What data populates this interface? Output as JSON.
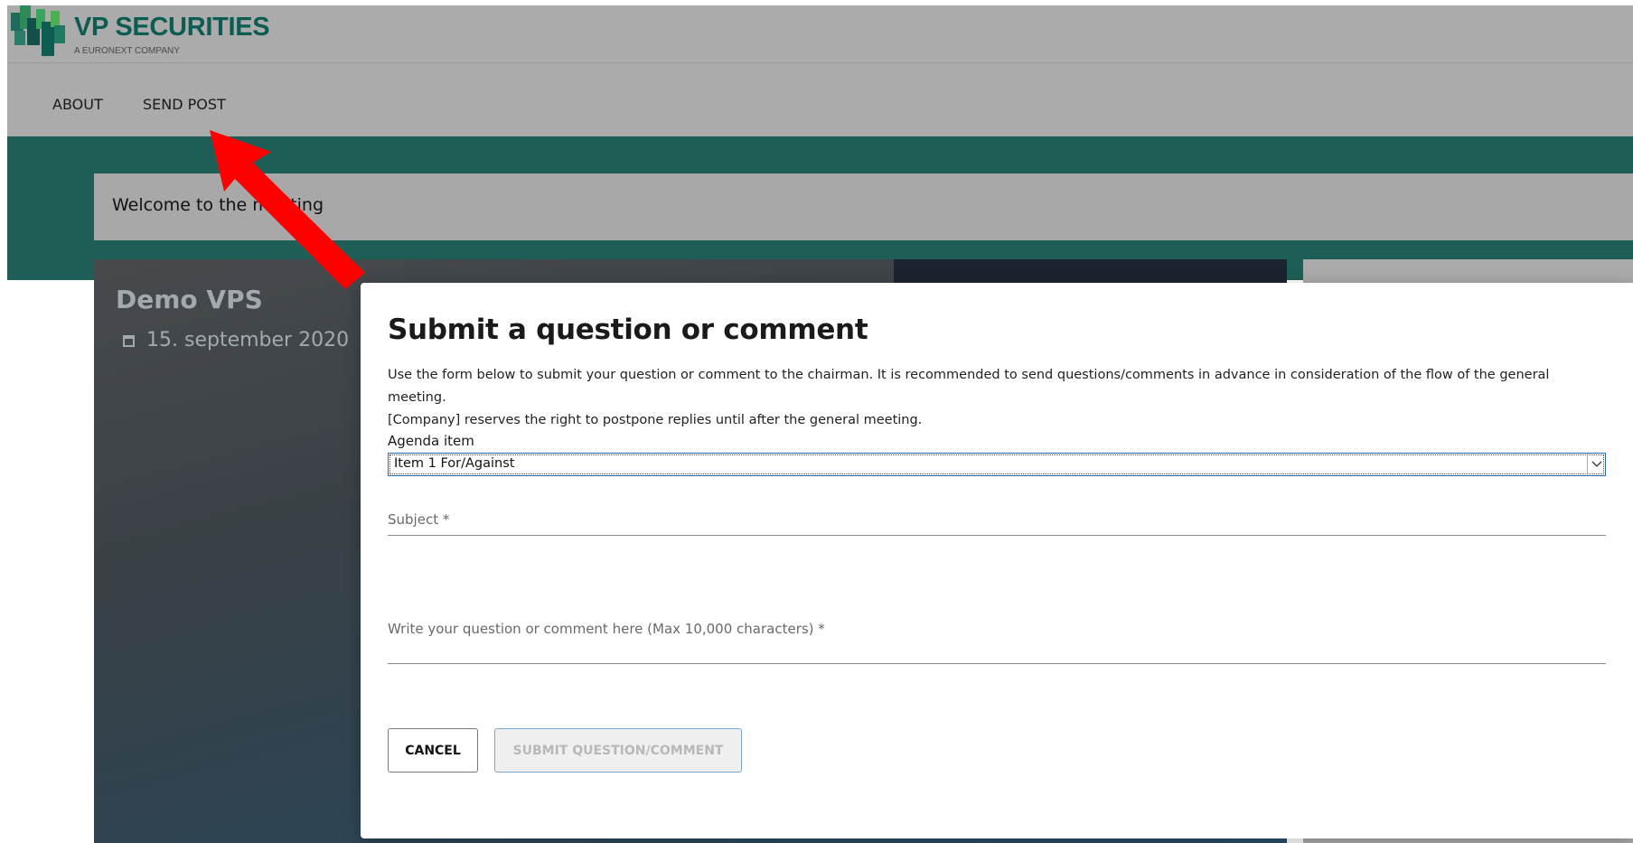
{
  "header": {
    "logo_title": "VP SECURITIES",
    "logo_subtitle": "A EURONEXT COMPANY"
  },
  "nav": {
    "items": [
      {
        "label": "ABOUT"
      },
      {
        "label": "SEND POST"
      }
    ]
  },
  "welcome": {
    "text": "Welcome to the meeting"
  },
  "hero": {
    "title": "Demo VPS",
    "date": "15. september 2020"
  },
  "modal": {
    "title": "Submit a question or comment",
    "description_line1": "Use the form below to submit your question or comment to the chairman. It is recommended to send questions/comments in advance in consideration of the flow of the general meeting.",
    "description_line2": "[Company] reserves the right to postpone replies until after the general meeting.",
    "agenda_label": "Agenda item",
    "agenda_selected": "Item 1 For/Against",
    "subject_placeholder": "Subject *",
    "question_placeholder": "Write your question or comment here (Max 10,000 characters) *",
    "cancel_label": "CANCEL",
    "submit_label": "SUBMIT QUESTION/COMMENT"
  },
  "colors": {
    "brand_green": "#0d5c52",
    "teal_band": "#1e5e56",
    "annotation_arrow": "#ff0000"
  },
  "icons": {
    "calendar": "calendar-icon",
    "dropdown": "chevron-down-icon",
    "annotation": "red-arrow-icon"
  }
}
